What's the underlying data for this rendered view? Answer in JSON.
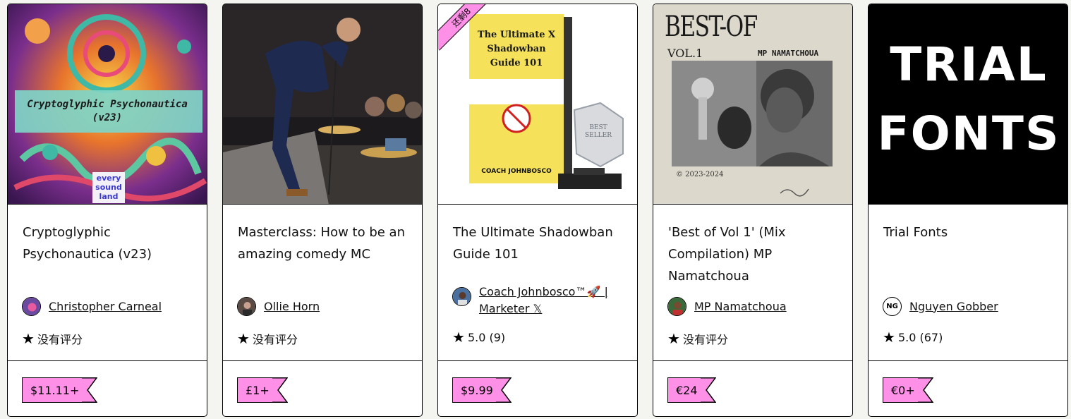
{
  "products": [
    {
      "title": "Cryptoglyphic Psychonautica (v23)",
      "thumb_caption": "Cryptoglyphic Psychonautica (v23)",
      "thumb_logo": "every sound land",
      "seller": "Christopher Carneal",
      "rating": "没有评分",
      "price": "$11.11+"
    },
    {
      "title": "Masterclass: How to be an amazing comedy MC",
      "seller": "Ollie Horn",
      "rating": "没有评分",
      "price": "£1+"
    },
    {
      "title": "The Ultimate Shadowban Guide 101",
      "ribbon": "还剩8",
      "book_title": "The Ultimate X Shadowban Guide 101",
      "book_author": "COACH JOHNBOSCO",
      "badge": "BEST SELLER",
      "seller": "Coach Johnbosco™🚀 | Marketer 𝕏",
      "rating": "5.0 (9)",
      "price": "$9.99"
    },
    {
      "title": "'Best of Vol 1' (Mix Compilation) MP Namatchoua",
      "cover_title": "BEST-OF",
      "cover_vol": "VOL.1",
      "cover_artist": "MP NAMATCHOUA",
      "cover_years": "© 2023-2024",
      "seller": "MP Namatchoua",
      "rating": "没有评分",
      "price": "€24"
    },
    {
      "title": "Trial Fonts",
      "cover_line1": "TRIAL",
      "cover_line2": "FONTS",
      "seller": "Nguyen Gobber",
      "seller_initials": "NG",
      "rating": "5.0 (67)",
      "price": "€0+"
    }
  ],
  "colors": {
    "accent": "#ff90e8",
    "page_bg": "#f4f4f0",
    "card_bg": "#ffffff"
  },
  "icons": {
    "rating": "star-icon",
    "price": "price-tag-icon"
  }
}
